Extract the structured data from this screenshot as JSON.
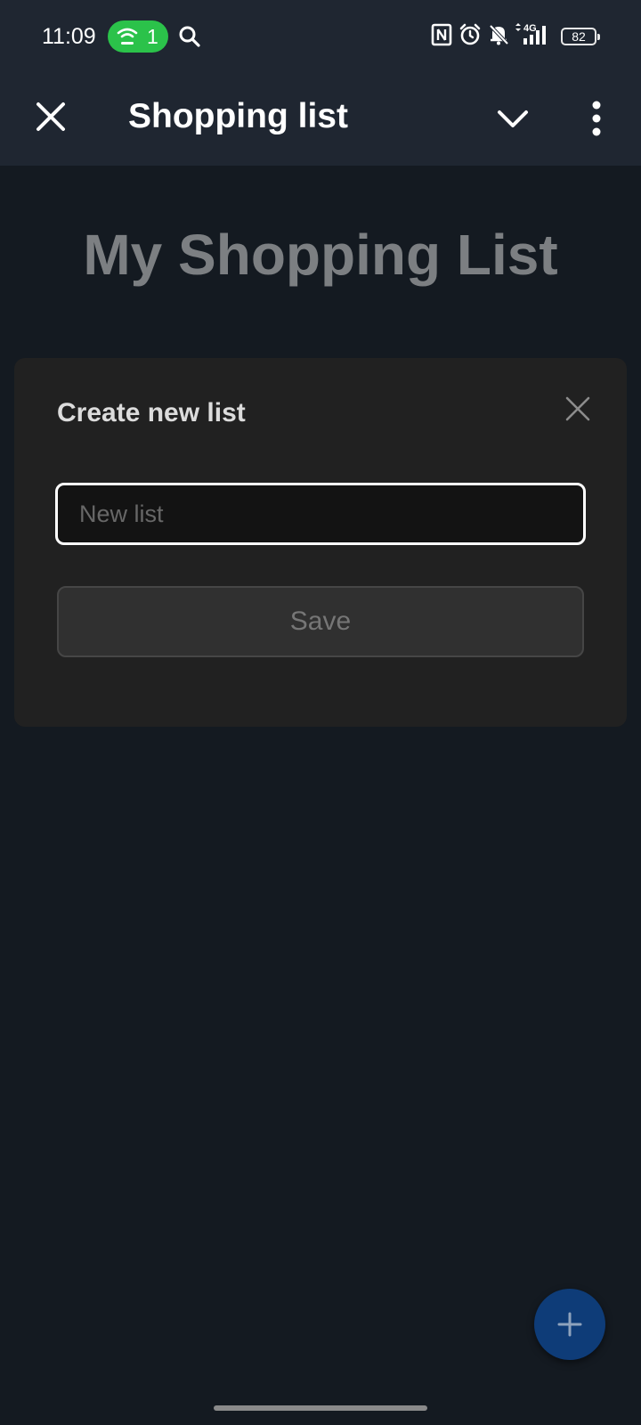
{
  "status_bar": {
    "time": "11:09",
    "hotspot_count": "1",
    "battery_level": "82",
    "network_label": "4G",
    "icons": [
      "hotspot-icon",
      "search-icon",
      "nfc-icon",
      "alarm-icon",
      "bell-off-icon",
      "signal-icon",
      "battery-icon"
    ]
  },
  "app_bar": {
    "title": "Shopping list",
    "icons": [
      "close-icon",
      "chevron-down-icon",
      "more-vert-icon"
    ]
  },
  "page": {
    "heading": "My Shopping List"
  },
  "dialog": {
    "title": "Create new list",
    "input_placeholder": "New list",
    "input_value": "",
    "save_label": "Save"
  },
  "fab": {
    "icon": "plus-icon"
  },
  "colors": {
    "status_bar_bg": "#1f2631",
    "page_bg": "#141a21",
    "dialog_bg": "#212121",
    "hotspot_green": "#2bc24a",
    "fab_blue": "#0e3c78"
  }
}
